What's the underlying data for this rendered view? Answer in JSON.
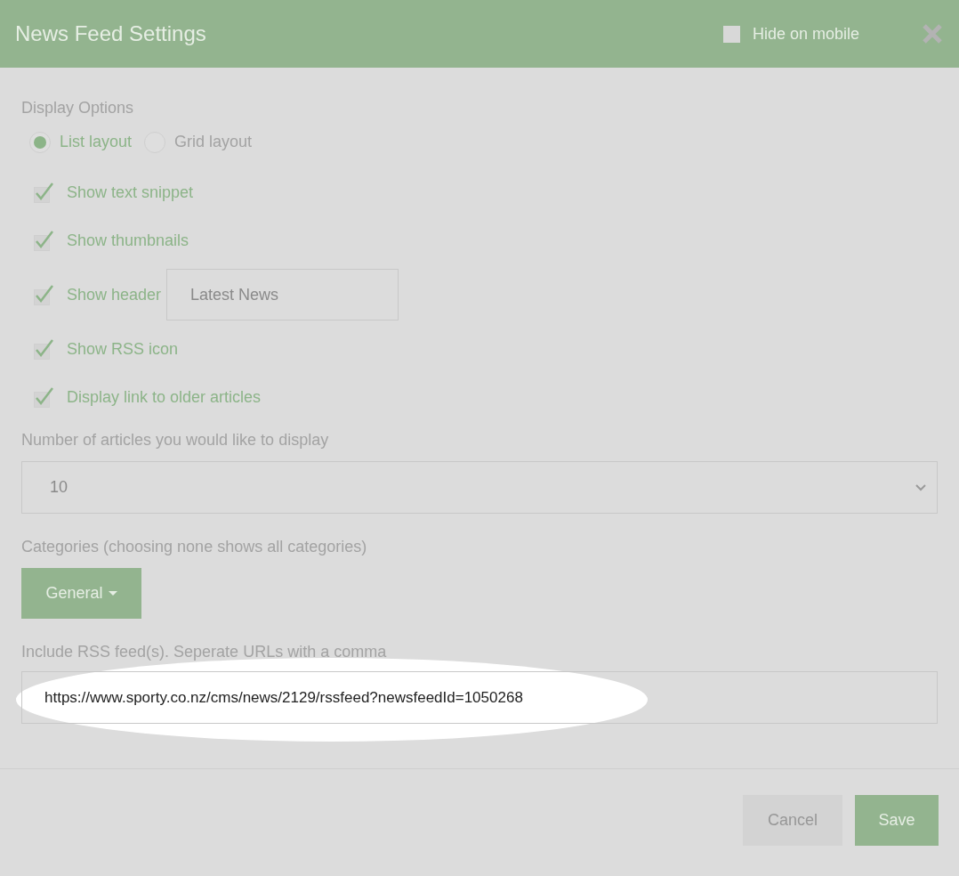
{
  "dialog": {
    "title": "News Feed Settings",
    "hide_on_mobile": {
      "label": "Hide on mobile",
      "checked": false
    }
  },
  "display_options": {
    "label": "Display Options",
    "layouts": [
      {
        "label": "List layout",
        "selected": true
      },
      {
        "label": "Grid layout",
        "selected": false
      }
    ],
    "checkboxes": [
      {
        "label": "Show text snippet",
        "checked": true
      },
      {
        "label": "Show thumbnails",
        "checked": true
      },
      {
        "label": "Show header",
        "checked": true,
        "field_value": "Latest News"
      },
      {
        "label": "Show RSS icon",
        "checked": true
      },
      {
        "label": "Display link to older articles",
        "checked": true
      }
    ]
  },
  "article_count": {
    "label": "Number of articles you would like to display",
    "value": "10"
  },
  "categories": {
    "label": "Categories (choosing none shows all categories)",
    "button": "General"
  },
  "rss_feeds": {
    "label": "Include RSS feed(s). Seperate URLs with a comma",
    "value": "https://www.sporty.co.nz/cms/news/2129/rssfeed?newsfeedId=1050268",
    "highlighted": true
  },
  "buttons": [
    {
      "label": "Cancel",
      "kind": "secondary"
    },
    {
      "label": "Save",
      "kind": "primary"
    }
  ]
}
